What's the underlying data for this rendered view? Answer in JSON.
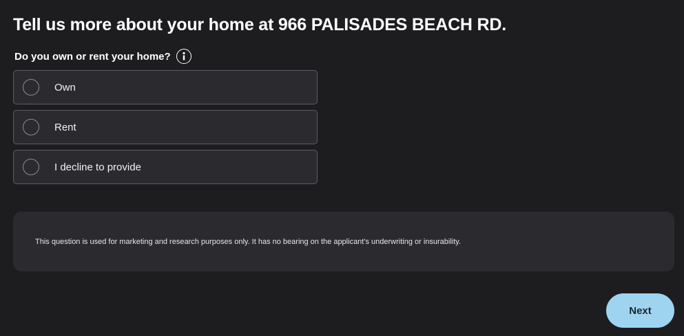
{
  "header": {
    "title": "Tell us more about your home at 966 PALISADES BEACH RD."
  },
  "question": {
    "label": "Do you own or rent your home?",
    "info_icon": "info-icon"
  },
  "options": [
    {
      "label": "Own",
      "selected": false
    },
    {
      "label": "Rent",
      "selected": false
    },
    {
      "label": "I decline to provide",
      "selected": false
    }
  ],
  "notice": {
    "text": "This question is used for marketing and research purposes only. It has no bearing on the applicant's underwriting or insurability."
  },
  "footer": {
    "next_label": "Next"
  },
  "colors": {
    "background": "#1d1d20",
    "panel": "#2b2b2f",
    "accent_button": "#9fd4f0"
  }
}
